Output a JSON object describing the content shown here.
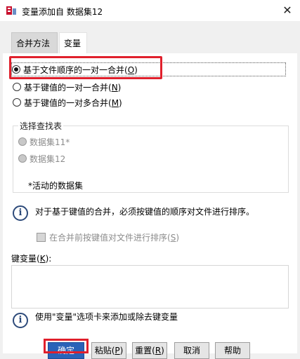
{
  "window": {
    "title": "变量添加自 数据集12",
    "close_glyph": "✕"
  },
  "tabs": [
    {
      "label": "合并方法"
    },
    {
      "label": "变量"
    }
  ],
  "merge_method": {
    "options": [
      {
        "prefix": "基于文件顺序的一对一合并(",
        "mnemonic": "O",
        "suffix": ")",
        "checked": true
      },
      {
        "prefix": "基于键值的一对一合并(",
        "mnemonic": "N",
        "suffix": ")",
        "checked": false
      },
      {
        "prefix": "基于键值的一对多合并(",
        "mnemonic": "M",
        "suffix": ")",
        "checked": false
      }
    ]
  },
  "lookup_table": {
    "title": "选择查找表",
    "options": [
      "数据集11*",
      "数据集12"
    ],
    "note": "*活动的数据集"
  },
  "info1": "对于基于键值的合并，必须按键值的顺序对文件进行排序。",
  "sort_checkbox": {
    "prefix": "在合并前按键值对文件进行排序(",
    "mnemonic": "S",
    "suffix": ")"
  },
  "key_vars": {
    "prefix": "键变量(",
    "mnemonic": "K",
    "suffix": "):"
  },
  "info2": "使用\"变量\"选项卡来添加或除去键变量",
  "buttons": {
    "ok": "确定",
    "paste": {
      "prefix": "粘贴(",
      "mnemonic": "P",
      "suffix": ")"
    },
    "reset": {
      "prefix": "重置(",
      "mnemonic": "R",
      "suffix": ")"
    },
    "cancel": "取消",
    "help": "帮助"
  },
  "colors": {
    "highlight": "#e0202c",
    "primary": "#2a62b8",
    "info": "#2d4a7a"
  }
}
